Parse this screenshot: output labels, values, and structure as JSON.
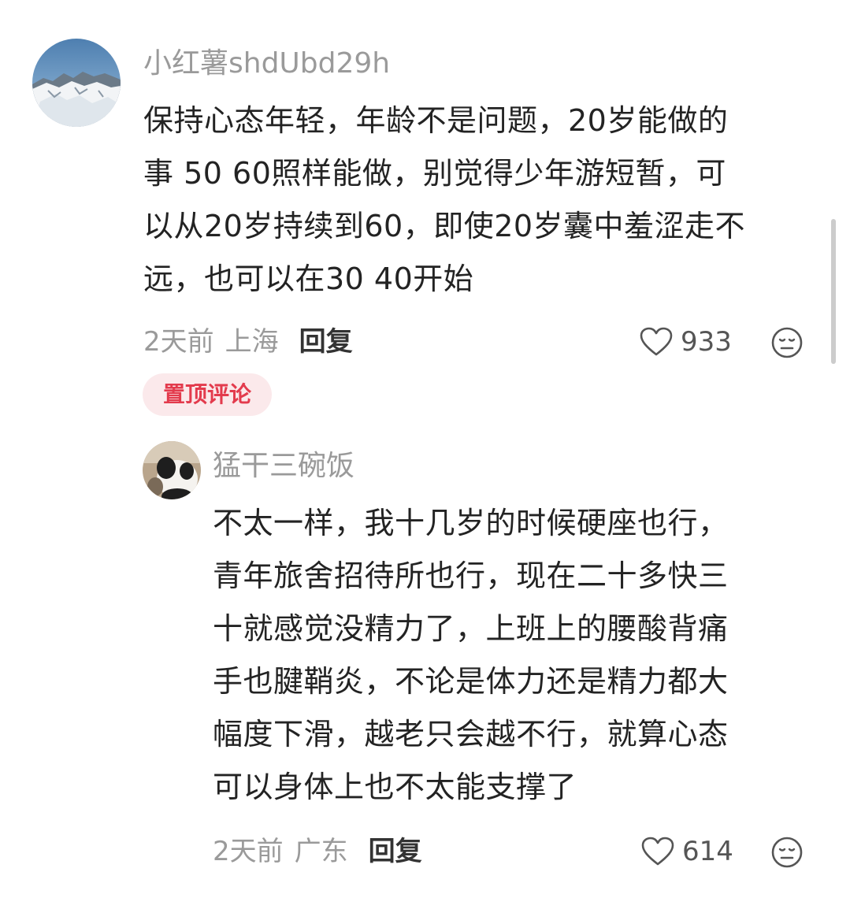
{
  "comments": [
    {
      "username": "小红薯shdUbd29h",
      "lines": [
        "保持心态年轻，年龄不是问题，20岁能做的",
        "事 50 60照样能做，别觉得少年游短暂，可",
        "以从20岁持续到60，即使20岁囊中羞涩走不",
        "远，也可以在30 40开始"
      ],
      "time": "2天前",
      "location": "上海",
      "reply_label": "回复",
      "likes": "933",
      "badge": "置顶评论",
      "avatar_icon": "snowy-mountain-avatar"
    },
    {
      "username": "猛干三碗饭",
      "lines": [
        "不太一样，我十几岁的时候硬座也行，",
        "青年旅舍招待所也行，现在二十多快三",
        "十就感觉没精力了，上班上的腰酸背痛",
        "手也腱鞘炎，不论是体力还是精力都大",
        "幅度下滑，越老只会越不行，就算心态",
        "可以身体上也不太能支撑了"
      ],
      "time": "2天前",
      "location": "广东",
      "reply_label": "回复",
      "likes": "614",
      "avatar_icon": "panda-avatar"
    }
  ],
  "colors": {
    "muted_text": "#9a9a9a",
    "body_text": "#232323",
    "badge_bg": "#fbe9eb",
    "badge_text": "#e33b4d"
  },
  "icons": [
    "heart-outline-icon",
    "neutral-face-icon"
  ]
}
